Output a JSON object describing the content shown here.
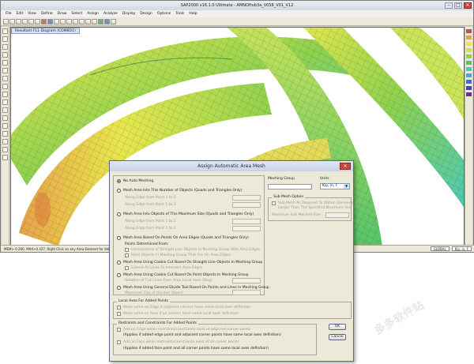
{
  "app": {
    "title": "SAP2000 v16.1.0 Ultimate  -  AMNOHub3a_V058_V01_V12",
    "menu": [
      "File",
      "Edit",
      "View",
      "Define",
      "Draw",
      "Select",
      "Assign",
      "Analyze",
      "Display",
      "Design",
      "Options",
      "Tools",
      "Help"
    ],
    "view_tab": "Resultant F11 Diagram (COMBO1)",
    "status_left": "MEM>-0.260,  MAX>0.427,  Right Click on any Area Element for detailed diagram",
    "status_right": [
      "GLOBAL",
      "Kip, in, F"
    ]
  },
  "dialog": {
    "title": "Assign Automatic Area Mesh",
    "options": {
      "no_auto": "No Auto Meshing",
      "number_of_objects": "Mesh Area Into This Number of Objects   (Quads and Triangles Only)",
      "along_edge_p1_p2": "Along Edge from Point 1 to 2",
      "along_edge_p1_p3": "Along Edge from Point 1 to 3",
      "max_size": "Mesh Area Into Objects of This Maximum Size   (Quads and Triangles Only)",
      "max_along_p1_p2": "Along Edge from Point 1 to 2",
      "max_along_p1_p3": "Along Edge from Point 1 to 3",
      "points_on_edges": "Mesh Area Based On Points On Area Edges   (Quads and Triangles Only)",
      "points_from_label": "Points Determined From:",
      "points_intersect": "Intersections of Straight Line Objects in Meshing Group With Area Edges",
      "points_point_objects": "Point Objects in Meshing Group That Are On Area Edges",
      "cookie_lines": "Mesh Area Using Cookie Cut Based On Straight Line Objects In Meshing Group",
      "extend_all_lines": "Extend All Lines To Intersect Area Edges",
      "cookie_points": "Mesh Area Using Cookie Cut Based On Point Objects In Meshing Group",
      "rotation_label": "Rotation of Cut Lines From Area Local Axes (Deg)",
      "general_divide": "Mesh Area Using General Divide Tool Based On  Points and Lines In Meshing Group",
      "max_divided_label": "Maximum Size of Divided Object"
    },
    "meshing_group_label": "Meshing Group",
    "units_label": "Units",
    "units_value": "Kip, in, F",
    "sub_mesh": {
      "legend": "Sub Mesh Option",
      "check_label_1": "Sub Mesh As Required To Obtain Elements No",
      "check_label_2": "Larger Than The Specified Maximum Size",
      "max_size_label": "Maximum Sub Meshed Size"
    },
    "local_axes": {
      "legend": "Local Axes For Added Points",
      "edge_label": "Make same on Edge if adjacent corners have same local axes definition",
      "face_label": "Make same on Face if all corners have same local axes definition"
    },
    "restraints": {
      "legend": "Restraints and Constraints For Added Points",
      "edge_label_1": "Add on Edge when restraints/constraints exist at adjacent corner points",
      "edge_label_2": "(Applies if added edge point and adjacent corner points have same local axes definition)",
      "face_label_1": "Add on Face when restraints/constraints exist at all corner points",
      "face_label_2": "(Applies if added face point and all corner points have same local axes definition)"
    },
    "ok_label": "OK",
    "cancel_label": "Cancel"
  },
  "watermark": "多多软件站",
  "colors": {
    "mesh_green": "#8fd14f",
    "mesh_yellow": "#e8e74e",
    "mesh_cyan": "#4cc9b4",
    "mesh_orange": "#e8a04a",
    "dialog_bg": "#ece9d8"
  }
}
